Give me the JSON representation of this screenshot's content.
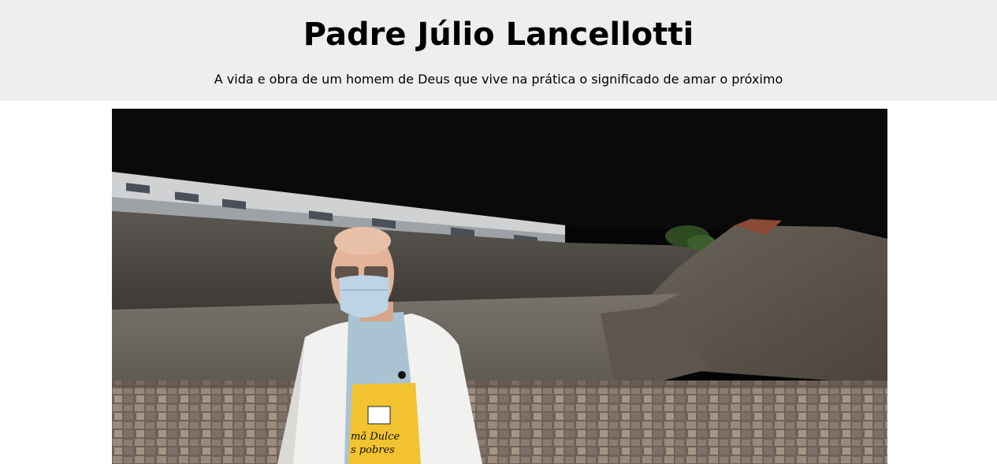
{
  "header": {
    "title": "Padre Júlio Lancellotti",
    "subtitle": "A vida e obra de um homem de Deus que vive na prática o significado de amar o próximo"
  },
  "photo": {
    "apron_text_line1": "mã Dulce",
    "apron_text_line2": "s pobres"
  },
  "colors": {
    "header_bg": "#eeeeee",
    "apron": "#f2c230"
  }
}
